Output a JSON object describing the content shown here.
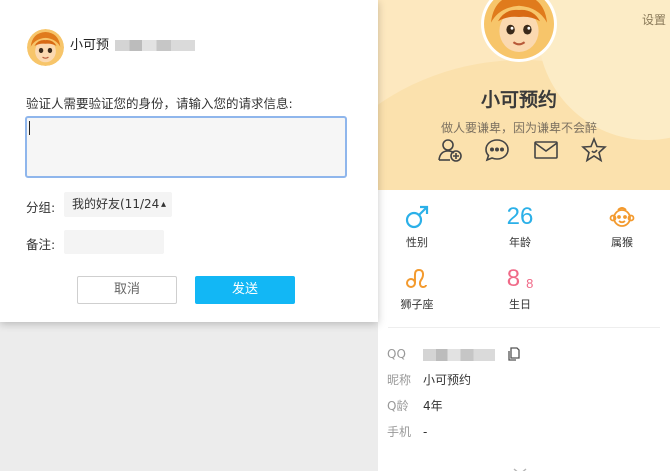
{
  "dialog": {
    "name_prefix": "小可预",
    "prompt": "验证人需要验证您的身份，请输入您的请求信息:",
    "request_text": "",
    "group_label": "分组:",
    "group_value": "我的好友(11/24",
    "remark_label": "备注:",
    "remark_value": "",
    "cancel_label": "取消",
    "send_label": "发送"
  },
  "profile": {
    "settings_label": "设置",
    "name": "小可预约",
    "signature": "做人要谦卑，因为谦卑不会醉",
    "actions": [
      "add-friend-icon",
      "chat-bubble-icon",
      "mail-icon",
      "star-icon"
    ],
    "stats": [
      {
        "label": "性别",
        "icon": "male-icon",
        "color": "#2bb0e8"
      },
      {
        "label": "年龄",
        "value": "26",
        "color": "#2bb0e8"
      },
      {
        "label": "属猴",
        "icon": "monkey-icon",
        "color": "#f39a2e"
      },
      {
        "label": "狮子座",
        "icon": "leo-icon",
        "color": "#f39a2e"
      },
      {
        "label": "生日",
        "value_main": "8",
        "value_sub": "8",
        "color": "#f06a88"
      }
    ],
    "info": [
      {
        "key": "QQ",
        "value": ""
      },
      {
        "key": "昵称",
        "value": "小可预约"
      },
      {
        "key": "Q龄",
        "value": "4年"
      },
      {
        "key": "手机",
        "value": "-"
      }
    ]
  },
  "colors": {
    "accent": "#12b7f5",
    "input_focus": "#8fb6ec",
    "banner": "#fde8bf"
  }
}
